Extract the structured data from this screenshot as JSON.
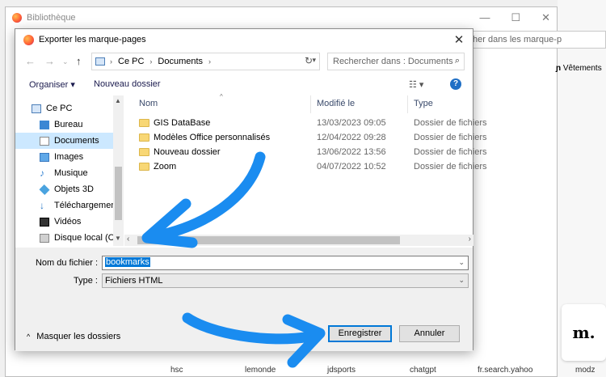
{
  "background": {
    "title": "Bibliothèque",
    "search_text": "her dans les marque-p",
    "toolbar_text": "Vêtements",
    "tiles": [
      "hsc",
      "lemonde",
      "jdsports",
      "chatgpt",
      "fr.search.yahoo",
      "modz"
    ],
    "tile_logo": "m."
  },
  "dialog": {
    "title": "Exporter les marque-pages",
    "breadcrumb": [
      "Ce PC",
      "Documents"
    ],
    "search_placeholder": "Rechercher dans : Documents",
    "toolbar": {
      "organize": "Organiser",
      "new_folder": "Nouveau dossier"
    },
    "nav_items": [
      {
        "label": "Ce PC",
        "icon": "computer-icon"
      },
      {
        "label": "Bureau",
        "icon": "desktop-icon"
      },
      {
        "label": "Documents",
        "icon": "documents-icon",
        "selected": true
      },
      {
        "label": "Images",
        "icon": "images-icon"
      },
      {
        "label": "Musique",
        "icon": "music-icon"
      },
      {
        "label": "Objets 3D",
        "icon": "3d-objects-icon"
      },
      {
        "label": "Téléchargements",
        "icon": "downloads-icon"
      },
      {
        "label": "Vidéos",
        "icon": "videos-icon"
      },
      {
        "label": "Disque local (C:)",
        "icon": "drive-icon"
      }
    ],
    "columns": {
      "name": "Nom",
      "modified": "Modifié le",
      "type": "Type"
    },
    "files": [
      {
        "name": "GIS DataBase",
        "date": "13/03/2023 09:05",
        "type": "Dossier de fichiers"
      },
      {
        "name": "Modèles Office personnalisés",
        "date": "12/04/2022 09:28",
        "type": "Dossier de fichiers"
      },
      {
        "name": "Nouveau dossier",
        "date": "13/06/2022 13:56",
        "type": "Dossier de fichiers"
      },
      {
        "name": "Zoom",
        "date": "04/07/2022 10:52",
        "type": "Dossier de fichiers"
      }
    ],
    "filename_label": "Nom du fichier :",
    "filename_value": "bookmarks",
    "type_label": "Type :",
    "type_value": "Fichiers HTML",
    "hide_folders": "Masquer les dossiers",
    "save_label": "Enregistrer",
    "cancel_label": "Annuler"
  },
  "colors": {
    "accent": "#0078d7",
    "annotation_arrow": "#1a8cf0",
    "selection": "#cce8ff"
  }
}
